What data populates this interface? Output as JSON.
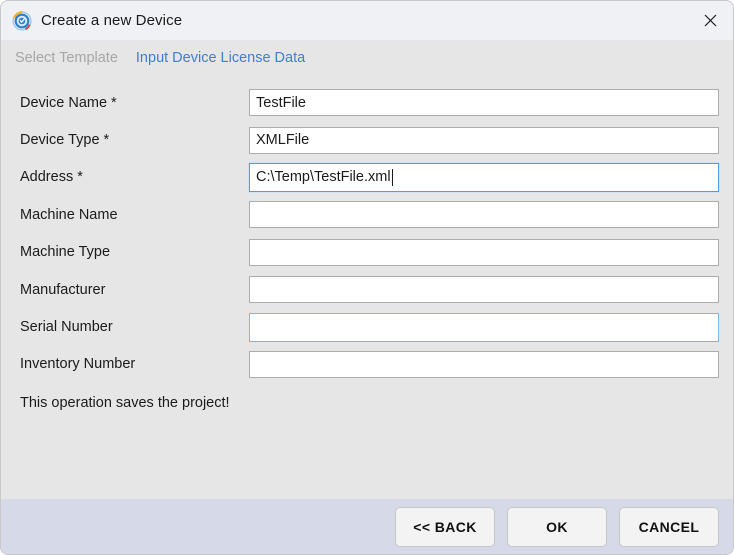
{
  "window": {
    "title": "Create a new Device",
    "icon": "app-badge-icon",
    "close_label": "×"
  },
  "steps": [
    {
      "label": "Select Template",
      "state": "inactive"
    },
    {
      "label": "Input Device License Data",
      "state": "active"
    }
  ],
  "form": {
    "fields": [
      {
        "label": "Device Name *",
        "value": "TestFile",
        "state": "normal",
        "caret": false
      },
      {
        "label": "Device Type *",
        "value": "XMLFile",
        "state": "normal",
        "caret": false
      },
      {
        "label": "Address *",
        "value": "C:\\Temp\\TestFile.xml",
        "state": "focused",
        "caret": true
      },
      {
        "label": "Machine Name",
        "value": "",
        "state": "normal",
        "caret": false
      },
      {
        "label": "Machine Type",
        "value": "",
        "state": "normal",
        "caret": false
      },
      {
        "label": "Manufacturer",
        "value": "",
        "state": "normal",
        "caret": false
      },
      {
        "label": "Serial Number",
        "value": "",
        "state": "hovered",
        "caret": false
      },
      {
        "label": "Inventory Number",
        "value": "",
        "state": "normal",
        "caret": false
      }
    ],
    "note": "This operation saves the project!"
  },
  "footer": {
    "buttons": [
      {
        "label": "<< BACK",
        "name": "back-button"
      },
      {
        "label": "OK",
        "name": "ok-button"
      },
      {
        "label": "CANCEL",
        "name": "cancel-button"
      }
    ]
  },
  "colors": {
    "titlebar": "#f0f1f5",
    "body": "#e6e6e6",
    "footer": "#d6dae8",
    "accent": "#3f7fd0",
    "focus_border": "#4a9eea",
    "disabled_text": "#a6a6a6"
  }
}
